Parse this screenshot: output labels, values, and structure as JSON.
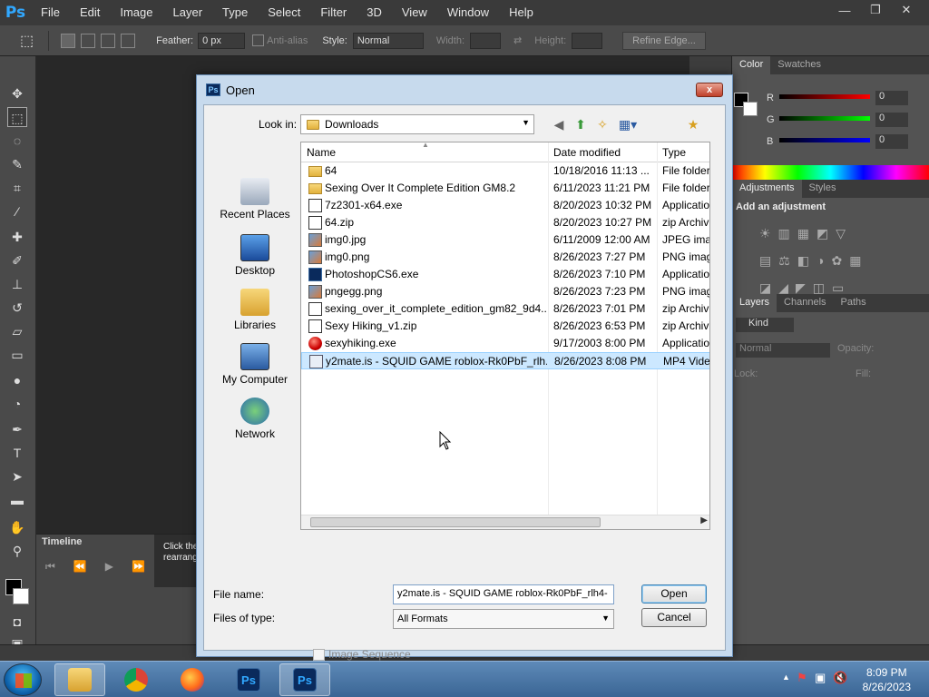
{
  "app": {
    "logo": "Ps",
    "menu": [
      "File",
      "Edit",
      "Image",
      "Layer",
      "Type",
      "Select",
      "Filter",
      "3D",
      "View",
      "Window",
      "Help"
    ],
    "window_controls": {
      "minimize": "—",
      "restore": "❐",
      "close": "✕"
    }
  },
  "options_bar": {
    "feather_label": "Feather:",
    "feather_value": "0 px",
    "antialias_label": "Anti-alias",
    "style_label": "Style:",
    "style_value": "Normal",
    "width_label": "Width:",
    "height_label": "Height:",
    "refine_edge": "Refine Edge..."
  },
  "right_panels": {
    "color_tabs": [
      "Color",
      "Swatches"
    ],
    "color_channels": [
      {
        "label": "R",
        "value": "0"
      },
      {
        "label": "G",
        "value": "0"
      },
      {
        "label": "B",
        "value": "0"
      }
    ],
    "adjustments_tabs": [
      "Adjustments",
      "Styles"
    ],
    "add_adjustment": "Add an adjustment",
    "layers_tabs": [
      "Layers",
      "Channels",
      "Paths"
    ],
    "kind_label": "Kind",
    "blend_mode": "Normal",
    "opacity_label": "Opacity:",
    "lock_label": "Lock:",
    "fill_label": "Fill:"
  },
  "timeline": {
    "tab": "Timeline",
    "tooltip": "Click the media to rearrang"
  },
  "dialog": {
    "title": "Open",
    "look_in_label": "Look in:",
    "look_in_value": "Downloads",
    "places": [
      "Recent Places",
      "Desktop",
      "Libraries",
      "My Computer",
      "Network"
    ],
    "columns": {
      "name": "Name",
      "date": "Date modified",
      "type": "Type"
    },
    "files": [
      {
        "icon": "folder",
        "name": "64",
        "date": "10/18/2016 11:13 ...",
        "type": "File folder"
      },
      {
        "icon": "folder",
        "name": "Sexing Over It Complete Edition GM8.2",
        "date": "6/11/2023 11:21 PM",
        "type": "File folder"
      },
      {
        "icon": "exe",
        "name": "7z2301-x64.exe",
        "date": "8/20/2023 10:32 PM",
        "type": "Applicatio"
      },
      {
        "icon": "zip",
        "name": "64.zip",
        "date": "8/20/2023 10:27 PM",
        "type": "zip Archiv"
      },
      {
        "icon": "img",
        "name": "img0.jpg",
        "date": "6/11/2009 12:00 AM",
        "type": "JPEG imag"
      },
      {
        "icon": "img",
        "name": "img0.png",
        "date": "8/26/2023 7:27 PM",
        "type": "PNG imag"
      },
      {
        "icon": "ps",
        "name": "PhotoshopCS6.exe",
        "date": "8/26/2023 7:10 PM",
        "type": "Applicatio"
      },
      {
        "icon": "img",
        "name": "pngegg.png",
        "date": "8/26/2023 7:23 PM",
        "type": "PNG imag"
      },
      {
        "icon": "zip",
        "name": "sexing_over_it_complete_edition_gm82_9d4...",
        "date": "8/26/2023 7:01 PM",
        "type": "zip Archiv"
      },
      {
        "icon": "zip",
        "name": "Sexy Hiking_v1.zip",
        "date": "8/26/2023 6:53 PM",
        "type": "zip Archiv"
      },
      {
        "icon": "red",
        "name": "sexyhiking.exe",
        "date": "9/17/2003 8:00 PM",
        "type": "Applicatio"
      },
      {
        "icon": "vid",
        "name": "y2mate.is - SQUID GAME roblox-Rk0PbF_rlh...",
        "date": "8/26/2023 8:08 PM",
        "type": "MP4 Vide",
        "selected": true
      }
    ],
    "file_name_label": "File name:",
    "file_name_value": "y2mate.is - SQUID GAME roblox-Rk0PbF_rlh4-",
    "files_of_type_label": "Files of type:",
    "files_of_type_value": "All Formats",
    "open_button": "Open",
    "cancel_button": "Cancel",
    "image_sequence": "Image Sequence",
    "close_glyph": "x"
  },
  "taskbar": {
    "clock_time": "8:09 PM",
    "clock_date": "8/26/2023"
  },
  "colors": {
    "ps_blue": "#31a8ff",
    "selection": "#cce8ff",
    "taskbar": "#3a6594"
  }
}
